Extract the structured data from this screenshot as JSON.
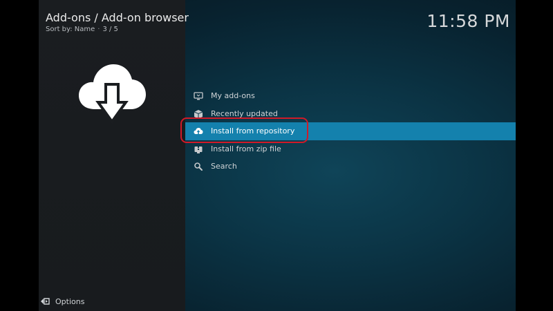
{
  "header": {
    "title": "Add-ons / Add-on browser",
    "sort_label": "Sort by: Name",
    "separator": "·",
    "position": "3 / 5"
  },
  "clock": "11:58 PM",
  "menu": {
    "items": [
      {
        "label": "My add-ons",
        "icon": "monitor-addon-icon"
      },
      {
        "label": "Recently updated",
        "icon": "box-icon"
      },
      {
        "label": "Install from repository",
        "icon": "cloud-upload-icon",
        "focused": true
      },
      {
        "label": "Install from zip file",
        "icon": "zip-file-icon"
      },
      {
        "label": "Search",
        "icon": "search-icon"
      }
    ]
  },
  "footer": {
    "options_label": "Options"
  },
  "colors": {
    "focus": "#1481ad",
    "annotation_ring": "#d11a28"
  }
}
